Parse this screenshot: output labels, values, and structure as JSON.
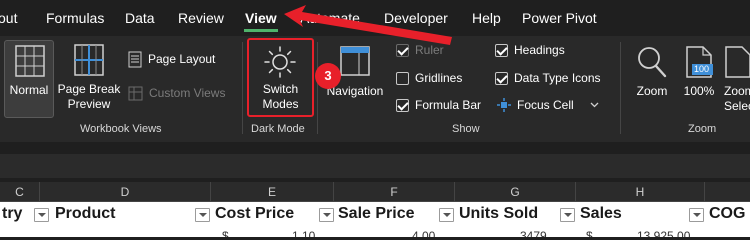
{
  "tabs": [
    {
      "label": "out"
    },
    {
      "label": "Formulas"
    },
    {
      "label": "Data"
    },
    {
      "label": "Review"
    },
    {
      "label": "View"
    },
    {
      "label": "Automate"
    },
    {
      "label": "Developer"
    },
    {
      "label": "Help"
    },
    {
      "label": "Power Pivot"
    }
  ],
  "ribbon": {
    "workbook_views": {
      "group_label": "Workbook Views",
      "normal": "Normal",
      "page_break_preview_line1": "Page Break",
      "page_break_preview_line2": "Preview",
      "page_layout": "Page Layout",
      "custom_views": "Custom Views"
    },
    "dark_mode": {
      "group_label": "Dark Mode",
      "switch_modes_line1": "Switch",
      "switch_modes_line2": "Modes"
    },
    "show": {
      "group_label": "Show",
      "navigation": "Navigation",
      "ruler": "Ruler",
      "gridlines": "Gridlines",
      "formula_bar": "Formula Bar",
      "headings": "Headings",
      "data_type_icons": "Data Type Icons",
      "focus_cell": "Focus Cell"
    },
    "zoom": {
      "group_label": "Zoom",
      "zoom": "Zoom",
      "hundred_percent": "100%",
      "zoom_icon_text": "100",
      "zoom_to_selection_line1": "Zoom",
      "zoom_to_selection_line2": "Selec"
    }
  },
  "annotation": {
    "step_number": "3"
  },
  "columns": [
    "C",
    "D",
    "E",
    "F",
    "G",
    "H"
  ],
  "table_headers": {
    "country_partial": "try",
    "product": "Product",
    "cost_price": "Cost Price",
    "sale_price": "Sale Price",
    "units_sold": "Units Sold",
    "sales": "Sales",
    "cogs_partial": "COG"
  },
  "first_row": {
    "cost_symbol": "$",
    "cost_value": "1.10",
    "sale_value": "4.00",
    "units": "3479",
    "sales_symbol": "$",
    "sales_value": "13,925.00"
  },
  "colors": {
    "accent_green": "#4fb36b",
    "annotation_red": "#e8202a",
    "ribbon_bg": "#292929"
  }
}
